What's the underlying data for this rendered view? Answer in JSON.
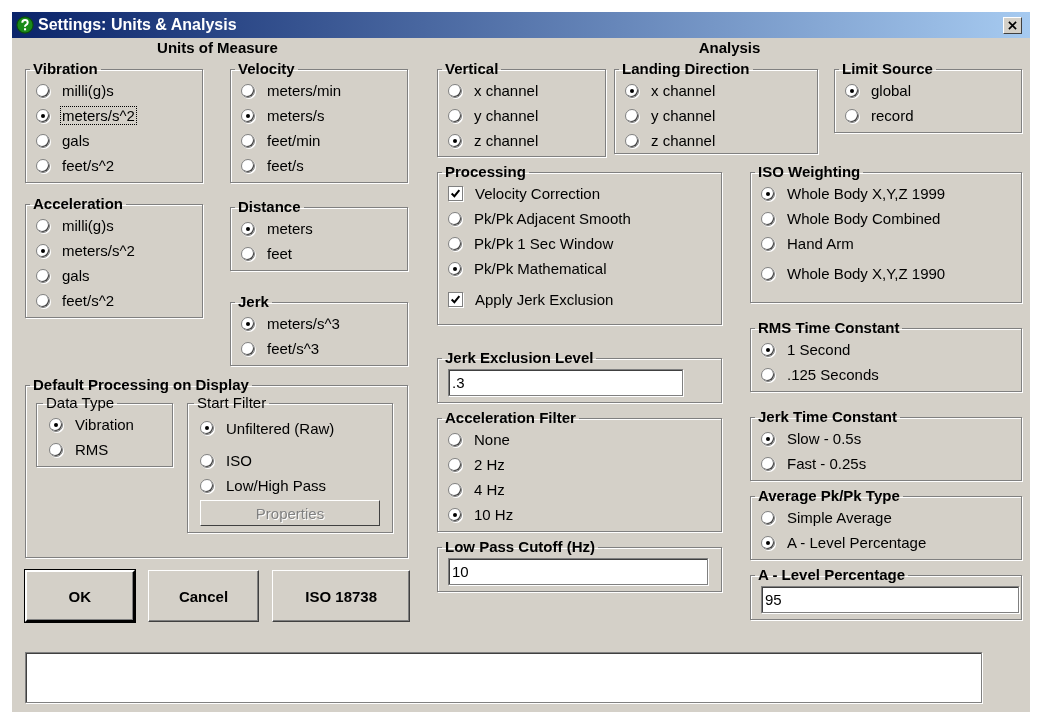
{
  "window": {
    "title": "Settings: Units & Analysis"
  },
  "units": {
    "heading": "Units of Measure",
    "columns": [
      [
        {
          "title": "Vibration",
          "items": [
            {
              "kind": "radio",
              "label": "milli(g)s",
              "selected": false
            },
            {
              "kind": "radio",
              "label": "meters/s^2",
              "selected": true,
              "focused": true
            },
            {
              "kind": "radio",
              "label": "gals",
              "selected": false
            },
            {
              "kind": "radio",
              "label": "feet/s^2",
              "selected": false
            }
          ]
        },
        {
          "title": "Acceleration",
          "items": [
            {
              "kind": "radio",
              "label": "milli(g)s",
              "selected": false
            },
            {
              "kind": "radio",
              "label": "meters/s^2",
              "selected": true
            },
            {
              "kind": "radio",
              "label": "gals",
              "selected": false
            },
            {
              "kind": "radio",
              "label": "feet/s^2",
              "selected": false
            }
          ]
        }
      ],
      [
        {
          "title": "Velocity",
          "items": [
            {
              "kind": "radio",
              "label": "meters/min",
              "selected": false
            },
            {
              "kind": "radio",
              "label": "meters/s",
              "selected": true
            },
            {
              "kind": "radio",
              "label": "feet/min",
              "selected": false
            },
            {
              "kind": "radio",
              "label": "feet/s",
              "selected": false
            }
          ]
        },
        {
          "title": "Distance",
          "items": [
            {
              "kind": "radio",
              "label": "meters",
              "selected": true
            },
            {
              "kind": "radio",
              "label": "feet",
              "selected": false
            }
          ]
        },
        {
          "title": "Jerk",
          "items": [
            {
              "kind": "radio",
              "label": "meters/s^3",
              "selected": true
            },
            {
              "kind": "radio",
              "label": "feet/s^3",
              "selected": false
            }
          ]
        }
      ]
    ],
    "default_processing": {
      "title": "Default Processing on Display",
      "groups": [
        {
          "title": "Data Type",
          "items": [
            {
              "kind": "radio",
              "label": "Vibration",
              "selected": true
            },
            {
              "kind": "radio",
              "label": "RMS",
              "selected": false
            }
          ]
        },
        {
          "title": "Start Filter",
          "items": [
            {
              "kind": "radio",
              "label": "Unfiltered (Raw)",
              "selected": true
            },
            {
              "kind": "radio",
              "label": "ISO",
              "selected": false
            },
            {
              "kind": "radio",
              "label": "Low/High Pass",
              "selected": false
            }
          ],
          "button": {
            "label": "Properties",
            "disabled": true
          }
        }
      ]
    }
  },
  "buttons": [
    {
      "label": "OK",
      "default": true
    },
    {
      "label": "Cancel",
      "default": false
    },
    {
      "label": "ISO 18738",
      "default": false
    }
  ],
  "analysis": {
    "heading": "Analysis",
    "top_row": [
      {
        "title": "Vertical",
        "items": [
          {
            "kind": "radio",
            "label": "x channel",
            "selected": false
          },
          {
            "kind": "radio",
            "label": "y channel",
            "selected": false
          },
          {
            "kind": "radio",
            "label": "z channel",
            "selected": true
          }
        ]
      },
      {
        "title": "Landing Direction",
        "items": [
          {
            "kind": "radio",
            "label": "x channel",
            "selected": true
          },
          {
            "kind": "radio",
            "label": "y channel",
            "selected": false
          },
          {
            "kind": "radio",
            "label": "z channel",
            "selected": false
          }
        ]
      },
      {
        "title": "Limit Source",
        "items": [
          {
            "kind": "radio",
            "label": "global",
            "selected": true
          },
          {
            "kind": "radio",
            "label": "record",
            "selected": false
          }
        ]
      }
    ],
    "columns": [
      [
        {
          "title": "Processing",
          "items": [
            {
              "kind": "checkbox",
              "label": "Velocity Correction",
              "checked": true
            },
            {
              "kind": "radio",
              "label": "Pk/Pk Adjacent Smooth",
              "selected": false
            },
            {
              "kind": "radio",
              "label": "Pk/Pk 1 Sec Window",
              "selected": false
            },
            {
              "kind": "radio",
              "label": "Pk/Pk Mathematical",
              "selected": true
            },
            {
              "kind": "checkbox",
              "label": "Apply Jerk Exclusion",
              "checked": true
            }
          ]
        },
        {
          "title": "Jerk Exclusion Level",
          "field": {
            "value": ".3"
          }
        },
        {
          "title": "Acceleration Filter",
          "items": [
            {
              "kind": "radio",
              "label": "None",
              "selected": false
            },
            {
              "kind": "radio",
              "label": "2 Hz",
              "selected": false
            },
            {
              "kind": "radio",
              "label": "4 Hz",
              "selected": false
            },
            {
              "kind": "radio",
              "label": "10 Hz",
              "selected": true
            }
          ]
        },
        {
          "title": "Low Pass Cutoff (Hz)",
          "field": {
            "value": "10"
          }
        }
      ],
      [
        {
          "title": "ISO Weighting",
          "items": [
            {
              "kind": "radio",
              "label": "Whole Body X,Y,Z 1999",
              "selected": true
            },
            {
              "kind": "radio",
              "label": "Whole Body Combined",
              "selected": false
            },
            {
              "kind": "radio",
              "label": "Hand Arm",
              "selected": false
            },
            {
              "kind": "radio",
              "label": "Whole Body X,Y,Z 1990",
              "selected": false
            }
          ]
        },
        {
          "title": "RMS Time Constant",
          "items": [
            {
              "kind": "radio",
              "label": "1 Second",
              "selected": true
            },
            {
              "kind": "radio",
              "label": ".125 Seconds",
              "selected": false
            }
          ]
        },
        {
          "title": "Jerk Time Constant",
          "items": [
            {
              "kind": "radio",
              "label": "Slow - 0.5s",
              "selected": true
            },
            {
              "kind": "radio",
              "label": "Fast - 0.25s",
              "selected": false
            }
          ]
        },
        {
          "title": "Average Pk/Pk Type",
          "items": [
            {
              "kind": "radio",
              "label": "Simple Average",
              "selected": false
            },
            {
              "kind": "radio",
              "label": "A - Level Percentage",
              "selected": true
            }
          ]
        },
        {
          "title": "A - Level Percentage",
          "field": {
            "value": "95"
          }
        }
      ]
    ]
  }
}
